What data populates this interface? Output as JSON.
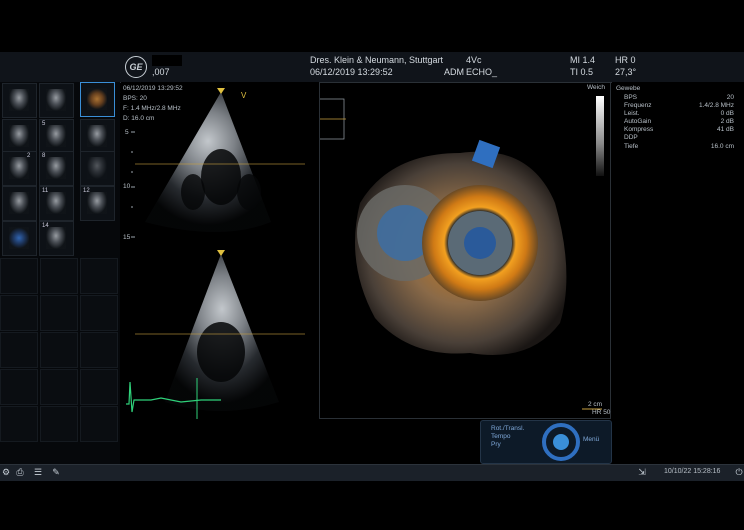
{
  "header": {
    "logo": "GE",
    "id_suffix": ",007",
    "institution": "Dres. Klein & Neumann, Stuttgart",
    "datetime": "06/12/2019 13:29:52",
    "probe": "4Vc",
    "adm": "ADM",
    "preset": "ECHO_",
    "mi": "MI 1.4",
    "ti": "TI 0.5",
    "hr": "HR 0",
    "angle": "27,3°"
  },
  "thumbnails": {
    "numbers": [
      "2",
      "5",
      "8",
      "11",
      "12",
      "14"
    ]
  },
  "view2d": {
    "datetime": "06/12/2019 13:29:52",
    "bps": "BPS: 20",
    "freq": "F: 1.4 MHz/2.8 MHz",
    "depth": "D: 16.0 cm",
    "marker_v": "V",
    "depth_ticks": [
      "5",
      "10",
      "15"
    ]
  },
  "view3d": {
    "gray_label": "Weich",
    "scale": "2 cm",
    "hr": "HR 50"
  },
  "params": {
    "title": "Gewebe",
    "rows": [
      {
        "k": "BPS",
        "v": "20"
      },
      {
        "k": "Frequenz",
        "v": "1.4/2.8 MHz"
      },
      {
        "k": "Leist.",
        "v": "0 dB"
      },
      {
        "k": "AutoGain",
        "v": "2 dB"
      },
      {
        "k": "Kompress",
        "v": "41 dB"
      },
      {
        "k": "DDP",
        "v": ""
      },
      {
        "k": "Tiefe",
        "v": "16.0 cm"
      }
    ]
  },
  "control": {
    "line1": "Rot./Transl.",
    "line2": "Tempo",
    "line3": "Pry",
    "menu": "Menü"
  },
  "status": {
    "datetime": "10/10/22 15:28:16"
  },
  "colors": {
    "accent": "#3a8fd8",
    "ecg": "#2fd17a",
    "cursor": "#c9a040"
  }
}
